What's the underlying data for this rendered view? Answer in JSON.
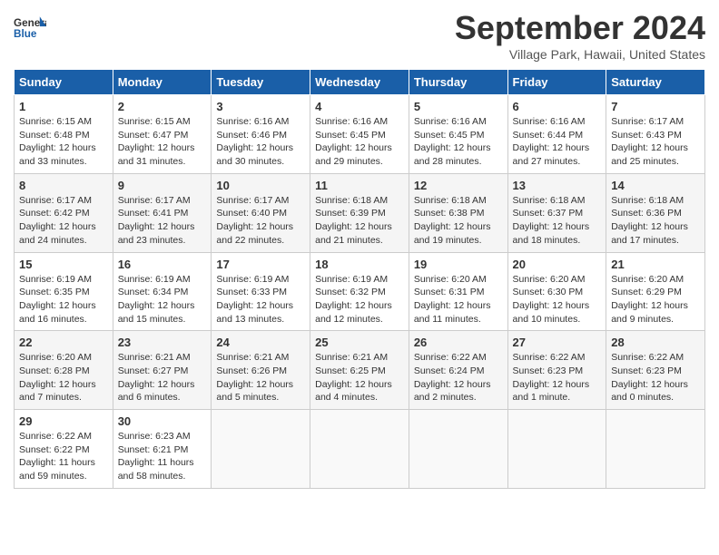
{
  "header": {
    "logo_line1": "General",
    "logo_line2": "Blue",
    "title": "September 2024",
    "location": "Village Park, Hawaii, United States"
  },
  "columns": [
    "Sunday",
    "Monday",
    "Tuesday",
    "Wednesday",
    "Thursday",
    "Friday",
    "Saturday"
  ],
  "weeks": [
    [
      {
        "day": "1",
        "sunrise": "6:15 AM",
        "sunset": "6:48 PM",
        "daylight": "Daylight: 12 hours and 33 minutes."
      },
      {
        "day": "2",
        "sunrise": "6:15 AM",
        "sunset": "6:47 PM",
        "daylight": "Daylight: 12 hours and 31 minutes."
      },
      {
        "day": "3",
        "sunrise": "6:16 AM",
        "sunset": "6:46 PM",
        "daylight": "Daylight: 12 hours and 30 minutes."
      },
      {
        "day": "4",
        "sunrise": "6:16 AM",
        "sunset": "6:45 PM",
        "daylight": "Daylight: 12 hours and 29 minutes."
      },
      {
        "day": "5",
        "sunrise": "6:16 AM",
        "sunset": "6:45 PM",
        "daylight": "Daylight: 12 hours and 28 minutes."
      },
      {
        "day": "6",
        "sunrise": "6:16 AM",
        "sunset": "6:44 PM",
        "daylight": "Daylight: 12 hours and 27 minutes."
      },
      {
        "day": "7",
        "sunrise": "6:17 AM",
        "sunset": "6:43 PM",
        "daylight": "Daylight: 12 hours and 25 minutes."
      }
    ],
    [
      {
        "day": "8",
        "sunrise": "6:17 AM",
        "sunset": "6:42 PM",
        "daylight": "Daylight: 12 hours and 24 minutes."
      },
      {
        "day": "9",
        "sunrise": "6:17 AM",
        "sunset": "6:41 PM",
        "daylight": "Daylight: 12 hours and 23 minutes."
      },
      {
        "day": "10",
        "sunrise": "6:17 AM",
        "sunset": "6:40 PM",
        "daylight": "Daylight: 12 hours and 22 minutes."
      },
      {
        "day": "11",
        "sunrise": "6:18 AM",
        "sunset": "6:39 PM",
        "daylight": "Daylight: 12 hours and 21 minutes."
      },
      {
        "day": "12",
        "sunrise": "6:18 AM",
        "sunset": "6:38 PM",
        "daylight": "Daylight: 12 hours and 19 minutes."
      },
      {
        "day": "13",
        "sunrise": "6:18 AM",
        "sunset": "6:37 PM",
        "daylight": "Daylight: 12 hours and 18 minutes."
      },
      {
        "day": "14",
        "sunrise": "6:18 AM",
        "sunset": "6:36 PM",
        "daylight": "Daylight: 12 hours and 17 minutes."
      }
    ],
    [
      {
        "day": "15",
        "sunrise": "6:19 AM",
        "sunset": "6:35 PM",
        "daylight": "Daylight: 12 hours and 16 minutes."
      },
      {
        "day": "16",
        "sunrise": "6:19 AM",
        "sunset": "6:34 PM",
        "daylight": "Daylight: 12 hours and 15 minutes."
      },
      {
        "day": "17",
        "sunrise": "6:19 AM",
        "sunset": "6:33 PM",
        "daylight": "Daylight: 12 hours and 13 minutes."
      },
      {
        "day": "18",
        "sunrise": "6:19 AM",
        "sunset": "6:32 PM",
        "daylight": "Daylight: 12 hours and 12 minutes."
      },
      {
        "day": "19",
        "sunrise": "6:20 AM",
        "sunset": "6:31 PM",
        "daylight": "Daylight: 12 hours and 11 minutes."
      },
      {
        "day": "20",
        "sunrise": "6:20 AM",
        "sunset": "6:30 PM",
        "daylight": "Daylight: 12 hours and 10 minutes."
      },
      {
        "day": "21",
        "sunrise": "6:20 AM",
        "sunset": "6:29 PM",
        "daylight": "Daylight: 12 hours and 9 minutes."
      }
    ],
    [
      {
        "day": "22",
        "sunrise": "6:20 AM",
        "sunset": "6:28 PM",
        "daylight": "Daylight: 12 hours and 7 minutes."
      },
      {
        "day": "23",
        "sunrise": "6:21 AM",
        "sunset": "6:27 PM",
        "daylight": "Daylight: 12 hours and 6 minutes."
      },
      {
        "day": "24",
        "sunrise": "6:21 AM",
        "sunset": "6:26 PM",
        "daylight": "Daylight: 12 hours and 5 minutes."
      },
      {
        "day": "25",
        "sunrise": "6:21 AM",
        "sunset": "6:25 PM",
        "daylight": "Daylight: 12 hours and 4 minutes."
      },
      {
        "day": "26",
        "sunrise": "6:22 AM",
        "sunset": "6:24 PM",
        "daylight": "Daylight: 12 hours and 2 minutes."
      },
      {
        "day": "27",
        "sunrise": "6:22 AM",
        "sunset": "6:23 PM",
        "daylight": "Daylight: 12 hours and 1 minute."
      },
      {
        "day": "28",
        "sunrise": "6:22 AM",
        "sunset": "6:23 PM",
        "daylight": "Daylight: 12 hours and 0 minutes."
      }
    ],
    [
      {
        "day": "29",
        "sunrise": "6:22 AM",
        "sunset": "6:22 PM",
        "daylight": "Daylight: 11 hours and 59 minutes."
      },
      {
        "day": "30",
        "sunrise": "6:23 AM",
        "sunset": "6:21 PM",
        "daylight": "Daylight: 11 hours and 58 minutes."
      },
      null,
      null,
      null,
      null,
      null
    ]
  ]
}
